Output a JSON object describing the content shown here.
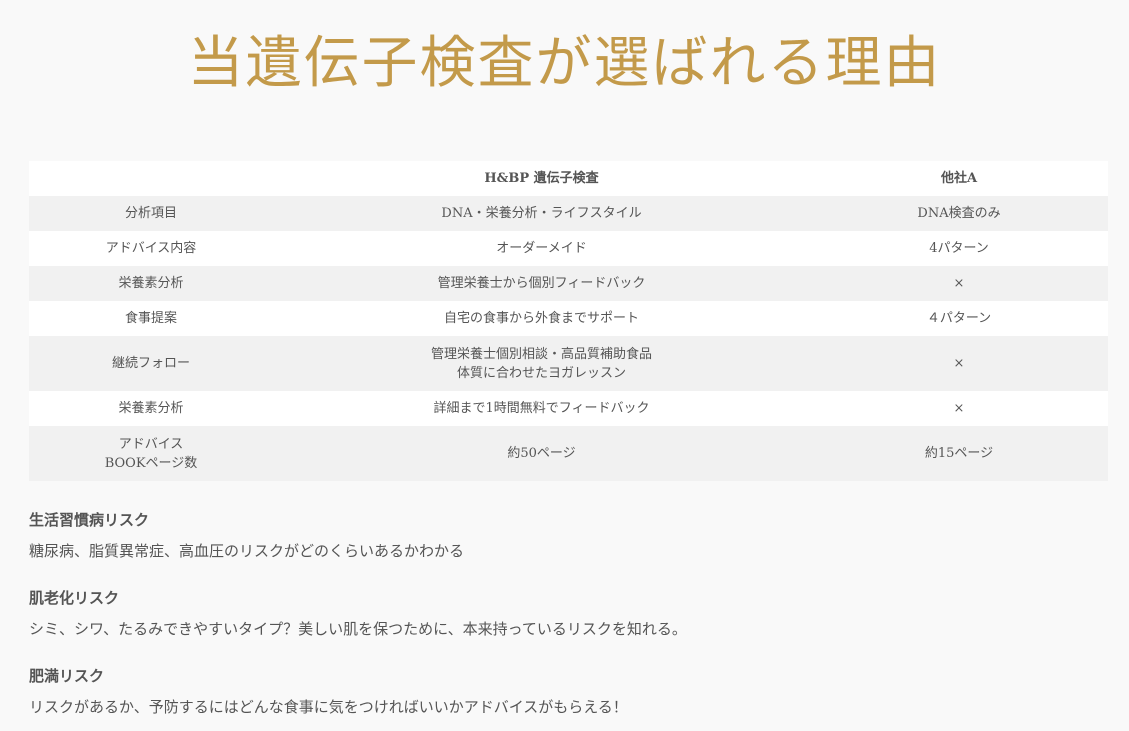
{
  "hero": {
    "title": "当遺伝子検査が選ばれる理由"
  },
  "comparison": {
    "headers": [
      "",
      "H&BP 遺伝子検査",
      "他社A"
    ],
    "rows": [
      {
        "label_lines": [
          "分析項目"
        ],
        "hbp_lines": [
          "DNA・栄養分析・ライフスタイル"
        ],
        "other_lines": [
          "DNA検査のみ"
        ]
      },
      {
        "label_lines": [
          "アドバイス内容"
        ],
        "hbp_lines": [
          "オーダーメイド"
        ],
        "other_lines": [
          "4パターン"
        ]
      },
      {
        "label_lines": [
          "栄養素分析"
        ],
        "hbp_lines": [
          "管理栄養士から個別フィードバック"
        ],
        "other_lines": [
          "×"
        ]
      },
      {
        "label_lines": [
          "食事提案"
        ],
        "hbp_lines": [
          "自宅の食事から外食までサポート"
        ],
        "other_lines": [
          "４パターン"
        ]
      },
      {
        "label_lines": [
          "継続フォロー"
        ],
        "hbp_lines": [
          "管理栄養士個別相談・高品質補助食品",
          "体質に合わせたヨガレッスン"
        ],
        "other_lines": [
          "×"
        ]
      },
      {
        "label_lines": [
          "栄養素分析"
        ],
        "hbp_lines": [
          "詳細まで1時間無料でフィードバック"
        ],
        "other_lines": [
          "×"
        ]
      },
      {
        "label_lines": [
          "アドバイス",
          "BOOKページ数"
        ],
        "hbp_lines": [
          "約50ページ"
        ],
        "other_lines": [
          "約15ページ"
        ]
      }
    ]
  },
  "risks": [
    {
      "heading": "生活習慣病リスク",
      "text": "糖尿病、脂質異常症、高血圧のリスクがどのくらいあるかわかる"
    },
    {
      "heading": "肌老化リスク",
      "text": "シミ、シワ、たるみできやすいタイプ？美しい肌を保つために、本来持っているリスクを知れる。"
    },
    {
      "heading": "肥満リスク",
      "text": "リスクがあるか、予防するにはどんな食事に気をつければいいかアドバイスがもらえる！"
    }
  ]
}
